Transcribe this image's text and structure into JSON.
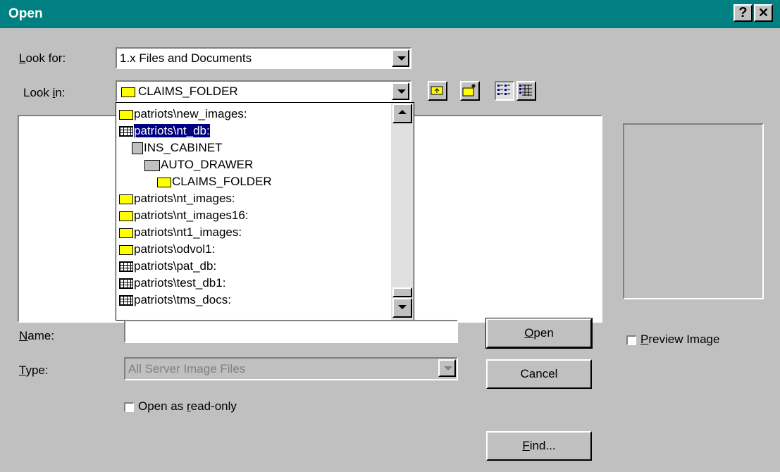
{
  "window": {
    "title": "Open",
    "help_glyph": "?",
    "close_glyph": "✕"
  },
  "look_for": {
    "label_key": "L",
    "label_rest": "ook for:",
    "value": "1.x Files and Documents"
  },
  "look_in": {
    "label_pre": "Look ",
    "label_key": "i",
    "label_post": "n:",
    "value": "CLAIMS_FOLDER"
  },
  "dropdown_items": [
    {
      "label": "patriots\\new_images:",
      "icon": "folder-icon"
    },
    {
      "label": "patriots\\nt_db:",
      "icon": "database-icon",
      "selected": true
    },
    {
      "label": "INS_CABINET",
      "icon": "cabinet-icon"
    },
    {
      "label": "AUTO_DRAWER",
      "icon": "drawer-icon"
    },
    {
      "label": "CLAIMS_FOLDER",
      "icon": "folder-icon"
    },
    {
      "label": "patriots\\nt_images:",
      "icon": "folder-icon"
    },
    {
      "label": "patriots\\nt_images16:",
      "icon": "folder-icon"
    },
    {
      "label": "patriots\\nt1_images:",
      "icon": "folder-icon"
    },
    {
      "label": "patriots\\odvol1:",
      "icon": "folder-icon"
    },
    {
      "label": "patriots\\pat_db:",
      "icon": "database-icon"
    },
    {
      "label": "patriots\\test_db1:",
      "icon": "database-icon"
    },
    {
      "label": "patriots\\tms_docs:",
      "icon": "database-icon"
    }
  ],
  "name": {
    "label_key": "N",
    "label_rest": "ame:",
    "value": ""
  },
  "type": {
    "label_key": "T",
    "label_rest": "ype:",
    "value": "All Server Image Files"
  },
  "read_only": {
    "label_pre": "Open as ",
    "label_key": "r",
    "label_post": "ead-only",
    "checked": false
  },
  "preview": {
    "label_key": "P",
    "label_rest": "review Image",
    "checked": false
  },
  "buttons": {
    "open_key": "O",
    "open_rest": "pen",
    "cancel": "Cancel",
    "find_key": "F",
    "find_rest": "ind..."
  },
  "colors": {
    "titlebar": "#008080",
    "dialog": "#c0c0c0",
    "selection": "#000080"
  }
}
